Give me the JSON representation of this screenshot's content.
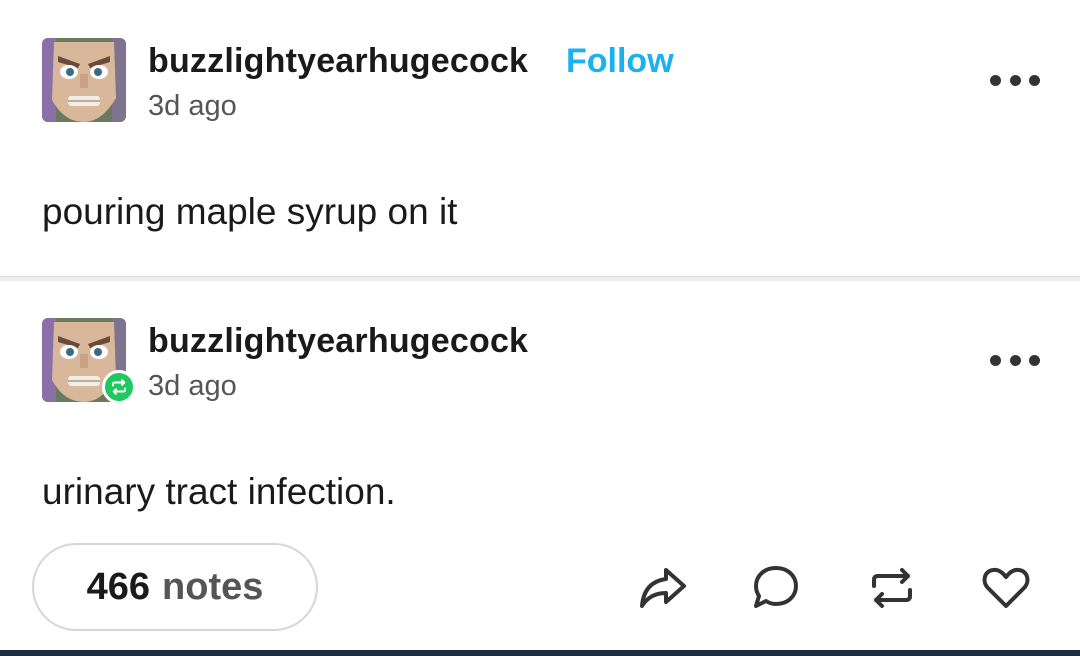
{
  "posts": [
    {
      "username": "buzzlightyearhugecock",
      "follow_label": "Follow",
      "time": "3d ago",
      "text": "pouring maple syrup on it",
      "avatar_icon": "buzz-lightyear-face-avatar"
    },
    {
      "username": "buzzlightyearhugecock",
      "time": "3d ago",
      "text": "urinary tract infection.",
      "avatar_icon": "buzz-lightyear-face-avatar",
      "badge_icon": "reblog-badge-icon"
    }
  ],
  "footer": {
    "notes_count": "466",
    "notes_label": "notes",
    "actions": [
      "share-icon",
      "reply-icon",
      "reblog-icon",
      "heart-icon"
    ]
  },
  "colors": {
    "follow": "#1bb1f0",
    "reblog_badge": "#1fc95f",
    "text": "#1a1a1a",
    "muted": "#555555"
  }
}
